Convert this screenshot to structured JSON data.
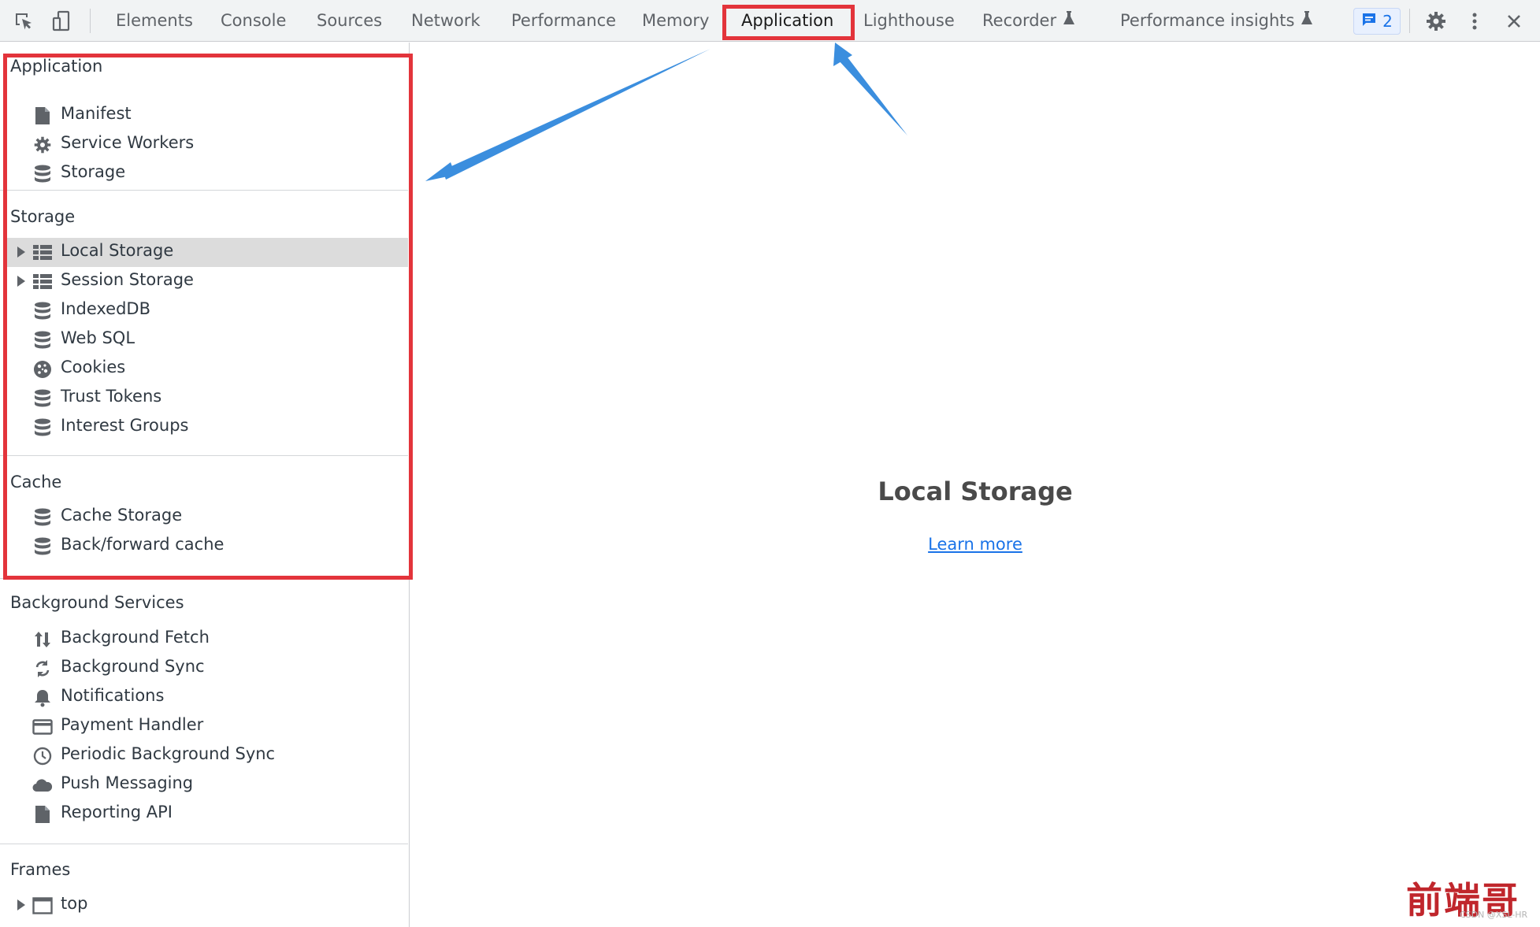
{
  "toolbar": {
    "tabs": [
      {
        "label": "Elements"
      },
      {
        "label": "Console"
      },
      {
        "label": "Sources"
      },
      {
        "label": "Network"
      },
      {
        "label": "Performance"
      },
      {
        "label": "Memory"
      },
      {
        "label": "Application",
        "active": true
      },
      {
        "label": "Lighthouse"
      },
      {
        "label": "Recorder"
      },
      {
        "label": "Performance insights"
      }
    ],
    "issues_count": "2",
    "icons": [
      "inspect-element-icon",
      "device-toolbar-icon",
      "flask-icon",
      "issues-icon",
      "gear-icon",
      "kebab-menu-icon",
      "close-icon"
    ]
  },
  "sidebar": {
    "sections": [
      {
        "title": "Application",
        "items": [
          {
            "label": "Manifest",
            "icon": "document-icon"
          },
          {
            "label": "Service Workers",
            "icon": "gear-icon"
          },
          {
            "label": "Storage",
            "icon": "database-icon"
          }
        ]
      },
      {
        "title": "Storage",
        "items": [
          {
            "label": "Local Storage",
            "icon": "table-icon",
            "expandable": true,
            "selected": true
          },
          {
            "label": "Session Storage",
            "icon": "table-icon",
            "expandable": true
          },
          {
            "label": "IndexedDB",
            "icon": "database-icon"
          },
          {
            "label": "Web SQL",
            "icon": "database-icon"
          },
          {
            "label": "Cookies",
            "icon": "cookie-icon"
          },
          {
            "label": "Trust Tokens",
            "icon": "database-icon"
          },
          {
            "label": "Interest Groups",
            "icon": "database-icon"
          }
        ]
      },
      {
        "title": "Cache",
        "items": [
          {
            "label": "Cache Storage",
            "icon": "database-icon"
          },
          {
            "label": "Back/forward cache",
            "icon": "database-icon"
          }
        ]
      },
      {
        "title": "Background Services",
        "items": [
          {
            "label": "Background Fetch",
            "icon": "up-down-arrows-icon"
          },
          {
            "label": "Background Sync",
            "icon": "sync-icon"
          },
          {
            "label": "Notifications",
            "icon": "bell-icon"
          },
          {
            "label": "Payment Handler",
            "icon": "credit-card-icon"
          },
          {
            "label": "Periodic Background Sync",
            "icon": "clock-icon"
          },
          {
            "label": "Push Messaging",
            "icon": "cloud-icon"
          },
          {
            "label": "Reporting API",
            "icon": "document-icon"
          }
        ]
      },
      {
        "title": "Frames",
        "items": [
          {
            "label": "top",
            "icon": "frame-icon",
            "expandable": true
          }
        ]
      }
    ]
  },
  "main": {
    "title": "Local Storage",
    "link": "Learn more"
  },
  "watermark": {
    "text": "前端哥",
    "small_text": "CSDN @XSL-HR"
  },
  "colors": {
    "highlight": "#e3343b",
    "arrow": "#3b8ede",
    "link": "#1a73e8",
    "selected_row": "#dcdcdc"
  }
}
